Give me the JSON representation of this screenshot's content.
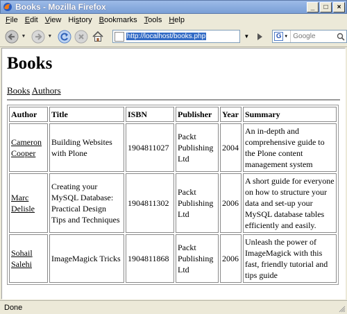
{
  "window": {
    "title": "Books - Mozilla Firefox",
    "buttons": [
      "_",
      "□",
      "×"
    ]
  },
  "menu": [
    {
      "accel": "F",
      "rest": "ile"
    },
    {
      "accel": "E",
      "rest": "dit"
    },
    {
      "accel": "V",
      "rest": "iew"
    },
    {
      "pre": "Hi",
      "accel": "s",
      "rest": "tory"
    },
    {
      "accel": "B",
      "rest": "ookmarks"
    },
    {
      "accel": "T",
      "rest": "ools"
    },
    {
      "accel": "H",
      "rest": "elp"
    }
  ],
  "toolbar": {
    "url": "http://localhost/books.php",
    "search_placeholder": "Google"
  },
  "page": {
    "heading": "Books",
    "links": [
      "Books",
      "Authors"
    ]
  },
  "table": {
    "headers": [
      "Author",
      "Title",
      "ISBN",
      "Publisher",
      "Year",
      "Summary"
    ],
    "rows": [
      {
        "author": "Cameron Cooper",
        "title": "Building Websites with Plone",
        "isbn": "1904811027",
        "publisher": "Packt Publishing Ltd",
        "year": "2004",
        "summary": "An in-depth and comprehensive guide to the Plone content management system"
      },
      {
        "author": "Marc Delisle",
        "title": "Creating your MySQL Database: Practical Design Tips and Techniques",
        "isbn": "1904811302",
        "publisher": "Packt Publishing Ltd",
        "year": "2006",
        "summary": "A short guide for everyone on how to structure your data and set-up your MySQL database tables efficiently and easily."
      },
      {
        "author": "Sohail Salehi",
        "title": "ImageMagick Tricks",
        "isbn": "1904811868",
        "publisher": "Packt Publishing Ltd",
        "year": "2006",
        "summary": "Unleash the power of ImageMagick with this fast, friendly tutorial and tips guide"
      }
    ]
  },
  "status": {
    "text": "Done"
  },
  "colors": {
    "titlebar": "#7a9fd6",
    "chrome": "#ece9d8",
    "url_selection": "#316ac5"
  }
}
